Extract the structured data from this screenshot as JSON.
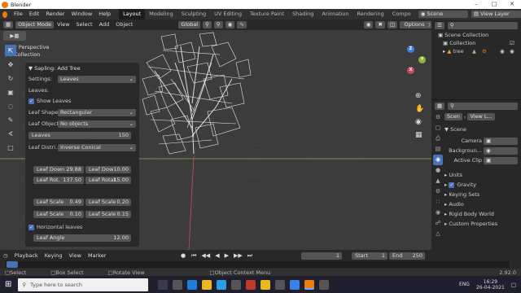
{
  "window": {
    "app_title": "Blender"
  },
  "menu": {
    "items": [
      "File",
      "Edit",
      "Render",
      "Window",
      "Help"
    ],
    "workspaces": [
      "Layout",
      "Modeling",
      "Sculpting",
      "UV Editing",
      "Texture Paint",
      "Shading",
      "Animation",
      "Rendering",
      "Compo"
    ],
    "scene_label": "Scene",
    "view_layer_label": "View Layer"
  },
  "viewport_header": {
    "mode": "Object Mode",
    "menus": [
      "View",
      "Select",
      "Add",
      "Object"
    ],
    "transform": "Global",
    "options": "Options"
  },
  "viewport": {
    "perspective": "User Perspective",
    "collection": "(1) Collection",
    "gizmo": {
      "z": "Z",
      "y": "Y",
      "x": "X"
    }
  },
  "operator_panel": {
    "title": "Sapling: Add Tree",
    "settings_label": "Settings:",
    "settings_value": "Leaves",
    "section_label": "Leaves:",
    "show_leaves": "Show Leaves",
    "leaf_shape_label": "Leaf Shape:",
    "leaf_shape_value": "Rectangular",
    "leaf_object_label": "Leaf Object:",
    "leaf_object_value": "No objects",
    "leaves_label": "Leaves",
    "leaves_value": "150",
    "leaf_distri_label": "Leaf Distri...",
    "leaf_distri_value": "Inverse Conical",
    "leaf_down_label": "Leaf Down",
    "leaf_down_value": "29.88",
    "leaf_dow2_label": "Leaf Dow",
    "leaf_dow2_value": "-10.00",
    "leaf_rot_label": "Leaf Rot.",
    "leaf_rot_value": "137.50",
    "leaf_rotat_label": "Leaf Rotat.",
    "leaf_rotat_value": "15.00",
    "leaf_scale1_label": "Leaf Scale",
    "leaf_scale1_value": "0.49",
    "leaf_scale2_label": "Leaf Scale",
    "leaf_scale2_value": "0.20",
    "leaf_scale3_label": "Leaf Scale",
    "leaf_scale3_value": "0.10",
    "leaf_scale4_label": "Leaf Scale",
    "leaf_scale4_value": "0.15",
    "horizontal_leaves": "Horizontal leaves",
    "leaf_angle_label": "Leaf Angle",
    "leaf_angle_value": "12.00"
  },
  "outliner": {
    "scene_collection": "Scene Collection",
    "collection": "Collection",
    "tree": "tree"
  },
  "properties": {
    "scene_tab": "Scen",
    "view_tab": "View L...",
    "scene_header": "Scene",
    "camera_label": "Camera",
    "background_label": "Backgroun...",
    "active_clip_label": "Active Clip",
    "units": "Units",
    "gravity": "Gravity",
    "keying_sets": "Keying Sets",
    "audio": "Audio",
    "rigid_body_world": "Rigid Body World",
    "custom_properties": "Custom Properties"
  },
  "timeline": {
    "menus": [
      "Playback",
      "Keying",
      "View",
      "Marker"
    ],
    "current_frame": "1",
    "start_label": "Start",
    "start_value": "1",
    "end_label": "End",
    "end_value": "250"
  },
  "statusbar": {
    "select": "Select",
    "box_select": "Box Select",
    "rotate_view": "Rotate View",
    "context_menu": "Object Context Menu",
    "version": "2.92.0"
  },
  "taskbar": {
    "search_placeholder": "Type here to search",
    "language": "ENG",
    "time": "16:29",
    "date": "26-04-2021"
  },
  "colors": {
    "accent": "#4772b3",
    "brand": "#e87d0d",
    "x_axis": "#c84d5b",
    "y_axis": "#8bb53d",
    "z_axis": "#3b80e6"
  },
  "icons": [
    "blender-logo-icon",
    "cursor-icon",
    "move-icon",
    "rotate-icon",
    "scale-icon",
    "transform-icon",
    "annotate-icon",
    "measure-icon",
    "add-cube-icon",
    "hand-icon",
    "zoom-icon",
    "camera-icon",
    "grid-icon",
    "search-icon",
    "windows-start-icon"
  ]
}
